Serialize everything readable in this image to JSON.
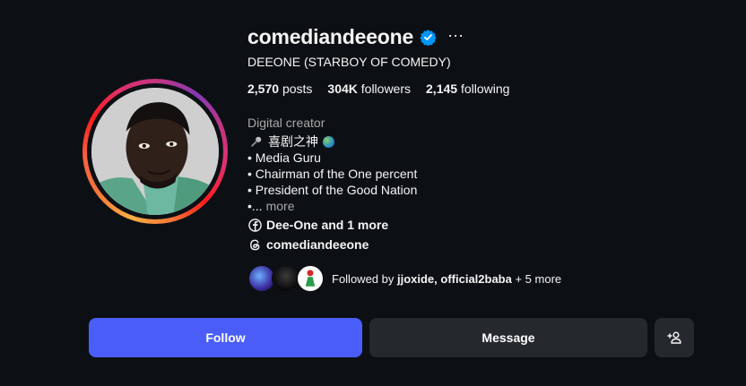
{
  "profile": {
    "username": "comediandeeone",
    "full_name": "DEEONE (STARBOY OF COMEDY)",
    "verified_icon": "verified-badge-icon",
    "more_icon": "ellipsis-icon",
    "more_label": "···"
  },
  "stats": {
    "posts_count": "2,570",
    "posts_label": "posts",
    "followers_count": "304K",
    "followers_label": "followers",
    "following_count": "2,145",
    "following_label": "following"
  },
  "bio": {
    "category": "Digital creator",
    "line1_text": "喜剧之神",
    "line2": "• Media Guru",
    "line3": "• Chairman of the One percent",
    "line4": "• President of the Good Nation",
    "line5_prefix": "•...",
    "more_label": "more"
  },
  "links": {
    "facebook_label": "Dee-One and 1 more",
    "threads_label": "comediandeeone"
  },
  "followed_by": {
    "prefix": "Followed by ",
    "names": "jjoxide, official2baba",
    "suffix": " + 5 more"
  },
  "actions": {
    "follow_label": "Follow",
    "message_label": "Message"
  },
  "colors": {
    "background": "#0c1014",
    "follow_button": "#4a5df9",
    "secondary_button": "#25292e",
    "verified": "#0095f6",
    "muted_text": "#a8a8a8"
  }
}
